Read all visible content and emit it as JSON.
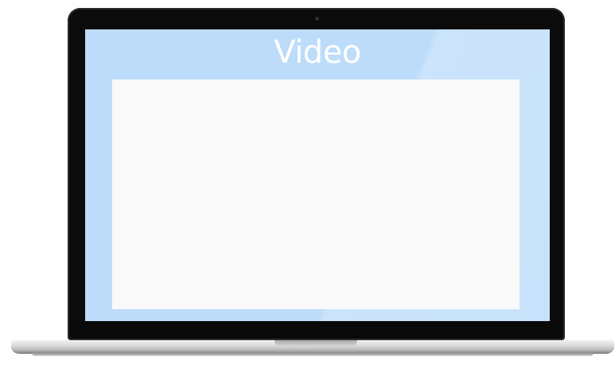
{
  "screen": {
    "title": "Video"
  },
  "colors": {
    "screen_background": "#bcdcfa",
    "video_area": "#f9f9f9",
    "bezel": "#0b0b0b"
  }
}
